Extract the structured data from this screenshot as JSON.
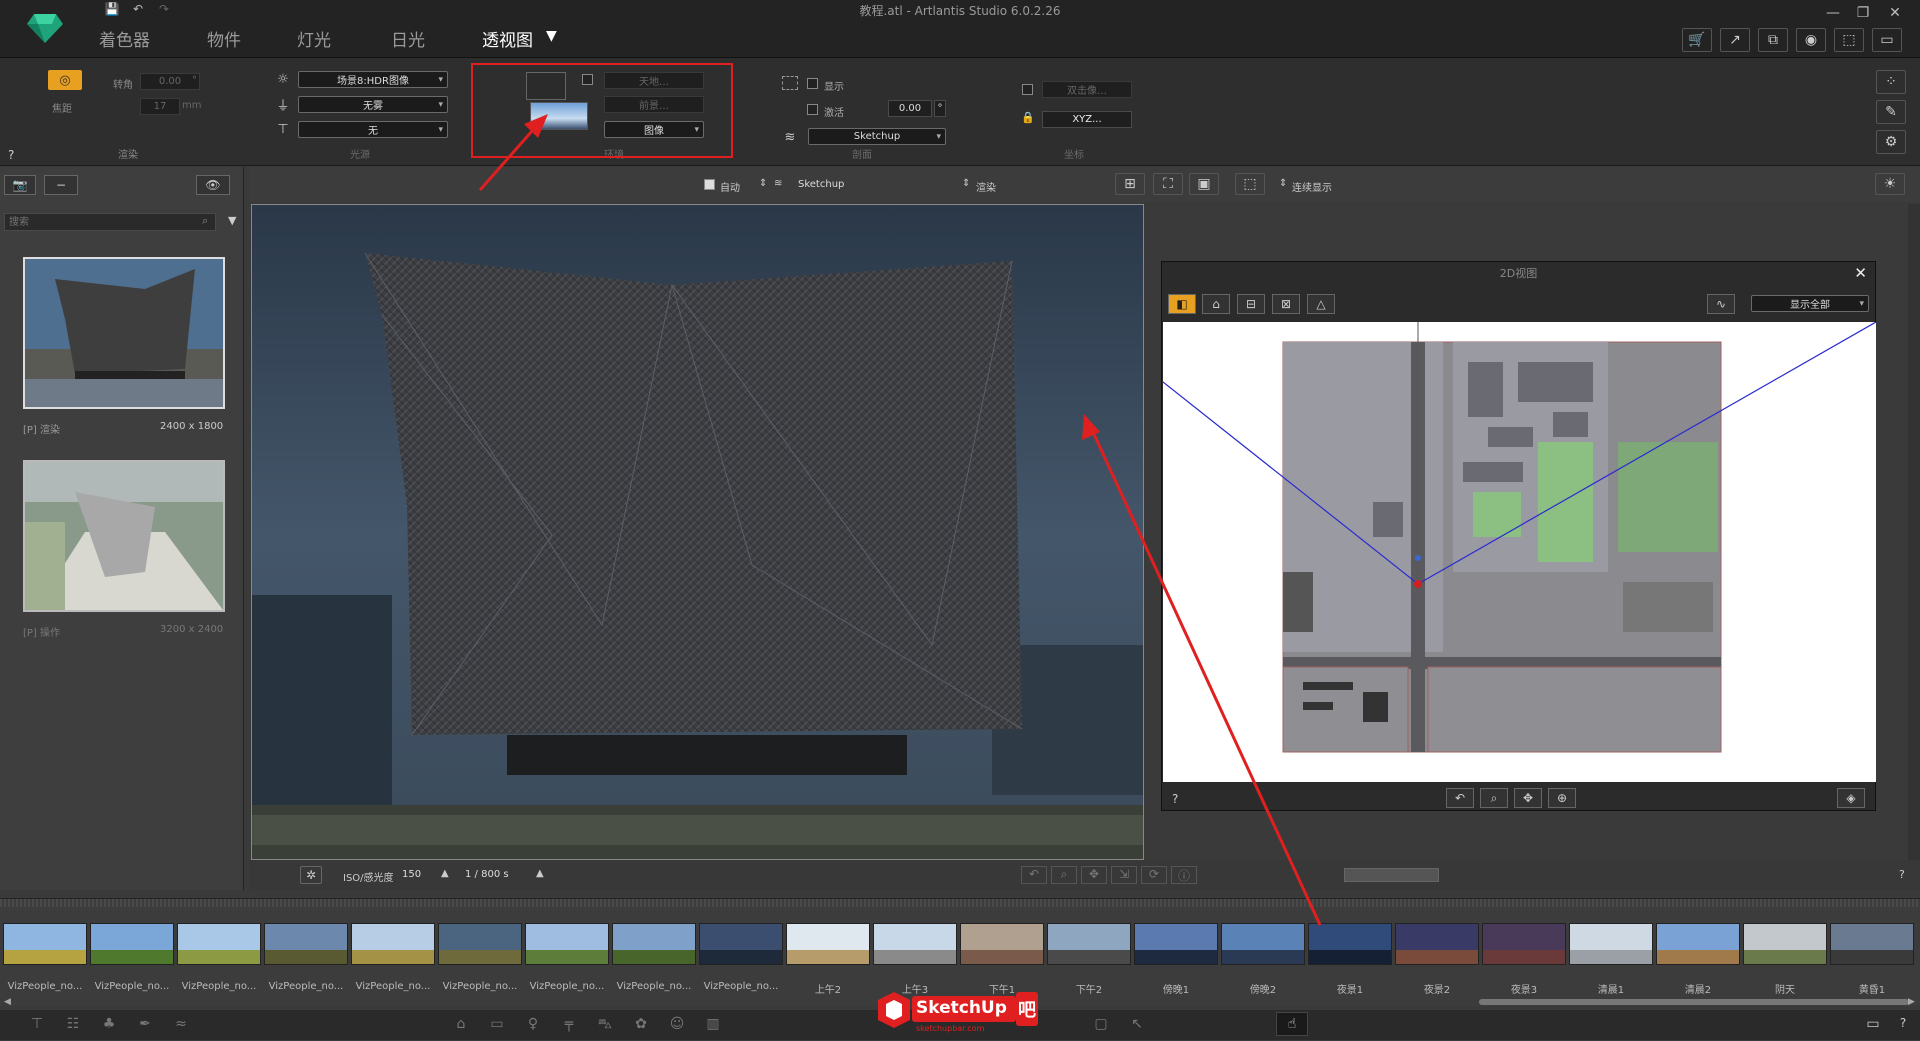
{
  "app": {
    "title": "教程.atl - Artlantis Studio 6.0.2.26",
    "menus": [
      {
        "label": "着色器",
        "active": false
      },
      {
        "label": "物件",
        "active": false
      },
      {
        "label": "灯光",
        "active": false
      },
      {
        "label": "日光",
        "active": false
      },
      {
        "label": "透视图",
        "active": true
      }
    ]
  },
  "ribbon": {
    "help": "?",
    "render_group": {
      "label": "渲染",
      "tilt_label": "转角",
      "tilt_value": "0.00",
      "tilt_unit": "°",
      "focal_label": "焦距",
      "focal_value": "17",
      "focal_unit": "mm"
    },
    "light_group": {
      "label": "光源",
      "sun_select": "场景8:HDR图像",
      "fog_select": "无雾",
      "shader_select": "无"
    },
    "bg_group": {
      "label": "环境",
      "field1": "天地…",
      "field2": "前景…",
      "mode_select": "图像"
    },
    "display_group": {
      "label": "剖面",
      "show_label": "显示",
      "activate_label": "激活",
      "value": "0.00",
      "unit": "°",
      "source_select": "Sketchup"
    },
    "coord_group": {
      "label": "坐标",
      "field1": "双击像…",
      "xyz_button": "XYZ..."
    }
  },
  "sidebar": {
    "search_placeholder": "搜索",
    "items": [
      {
        "label": "[P] 渲染",
        "size": "2400 x 1800"
      },
      {
        "label": "[P] 操作",
        "size": "3200 x 2400"
      }
    ]
  },
  "viewbar": {
    "auto_label": "自动",
    "source": "Sketchup",
    "render_label": "渲染",
    "display_label": "连续显示"
  },
  "viewport_bottom": {
    "iso_label": "ISO/感光度",
    "iso_value": "150",
    "shutter": "1 / 800 s"
  },
  "window2d": {
    "title": "2D视图",
    "view_select": "显示全部",
    "help": "?"
  },
  "bottom_help": "?",
  "environments": [
    {
      "label": "VizPeople_no...",
      "sky": "#8fb6e0",
      "ground": "#b5a240"
    },
    {
      "label": "VizPeople_no...",
      "sky": "#7ba7d8",
      "ground": "#4f7a2e"
    },
    {
      "label": "VizPeople_no...",
      "sky": "#a9c7e6",
      "ground": "#8c9a44"
    },
    {
      "label": "VizPeople_no...",
      "sky": "#6c89ad",
      "ground": "#5a5a32"
    },
    {
      "label": "VizPeople_no...",
      "sky": "#b7cde6",
      "ground": "#a49246"
    },
    {
      "label": "VizPeople_no...",
      "sky": "#4b6480",
      "ground": "#6e6a3c"
    },
    {
      "label": "VizPeople_no...",
      "sky": "#9fbde0",
      "ground": "#5d7e3a"
    },
    {
      "label": "VizPeople_no...",
      "sky": "#7fa0c8",
      "ground": "#48662c"
    },
    {
      "label": "VizPeople_no...",
      "sky": "#3c4e70",
      "ground": "#1e2a3a"
    },
    {
      "label": "上午2",
      "sky": "#dfe8ef",
      "ground": "#b59c6a"
    },
    {
      "label": "上午3",
      "sky": "#c8d8e8",
      "ground": "#8a8a8a"
    },
    {
      "label": "下午1",
      "sky": "#b0a090",
      "ground": "#7a5a4a"
    },
    {
      "label": "下午2",
      "sky": "#8fa6c0",
      "ground": "#4a4a4a"
    },
    {
      "label": "傍晚1",
      "sky": "#5a7ab0",
      "ground": "#1e2a40"
    },
    {
      "label": "傍晚2",
      "sky": "#5b82b6",
      "ground": "#2a3a55"
    },
    {
      "label": "夜景1",
      "sky": "#304a7a",
      "ground": "#152035"
    },
    {
      "label": "夜景2",
      "sky": "#3a3a66",
      "ground": "#7a4a3a"
    },
    {
      "label": "夜景3",
      "sky": "#4a3a5a",
      "ground": "#6a3a3a"
    },
    {
      "label": "清晨1",
      "sky": "#cfd9e4",
      "ground": "#9aa0a6"
    },
    {
      "label": "清晨2",
      "sky": "#7aa2d4",
      "ground": "#a07a4a"
    },
    {
      "label": "阴天",
      "sky": "#c2c8cc",
      "ground": "#6a7a4a"
    },
    {
      "label": "黄昏1",
      "sky": "#6a7a90",
      "ground": "#3a3a3a"
    }
  ],
  "watermark": {
    "brand": "SketchUp",
    "suffix": "吧",
    "url": "sketchupbar.com"
  }
}
